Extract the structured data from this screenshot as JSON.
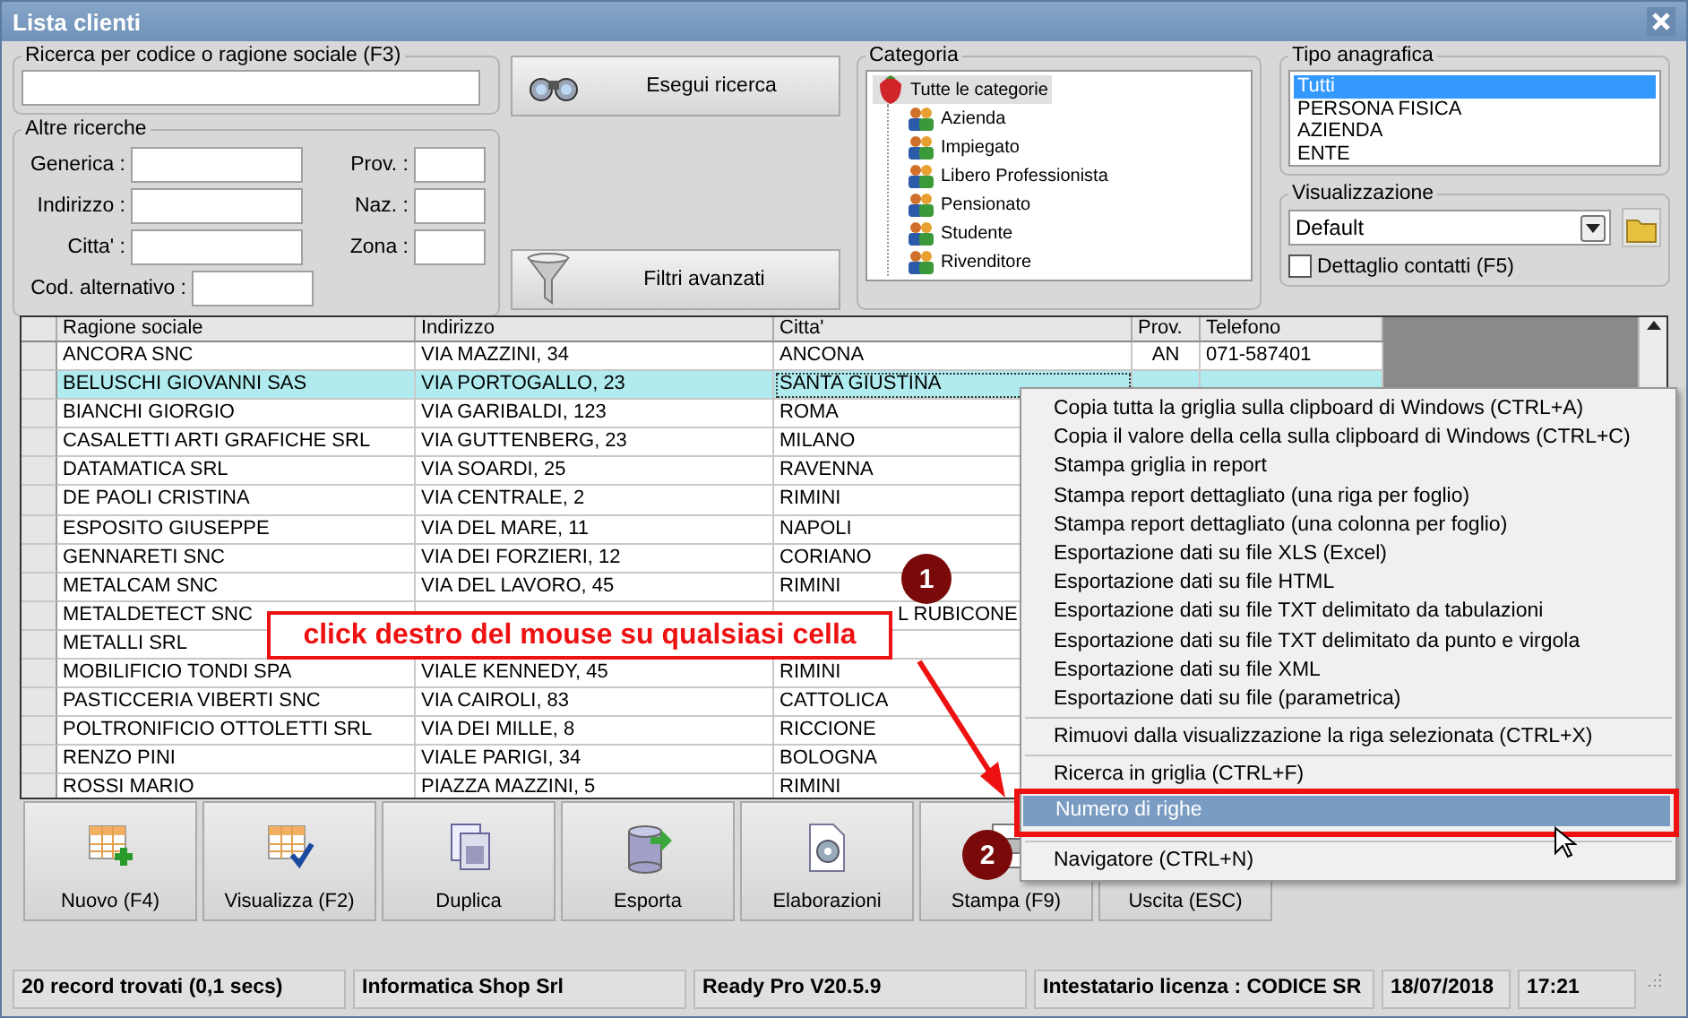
{
  "window": {
    "title": "Lista clienti"
  },
  "search": {
    "legend": "Ricerca per codice o ragione sociale (F3)"
  },
  "other_search": {
    "legend": "Altre ricerche",
    "rows": [
      {
        "fields": [
          {
            "label": "Generica :",
            "kind": "wide"
          },
          {
            "label": "Prov. :",
            "kind": "narrow"
          }
        ]
      },
      {
        "fields": [
          {
            "label": "Indirizzo :",
            "kind": "wide"
          },
          {
            "label": "Naz. :",
            "kind": "narrow"
          }
        ]
      },
      {
        "fields": [
          {
            "label": "Citta' :",
            "kind": "wide"
          },
          {
            "label": "Zona :",
            "kind": "narrow"
          }
        ]
      },
      {
        "fields": [
          {
            "label": "Cod. alternativo :",
            "kind": "medium"
          }
        ]
      }
    ]
  },
  "search_buttons": [
    {
      "label": "Esegui ricerca",
      "kind": "binoculars"
    },
    {
      "label": "Filtri avanzati",
      "kind": "funnel"
    }
  ],
  "category": {
    "legend": "Categoria",
    "tree": [
      {
        "label": "Tutte le categorie",
        "selected": true,
        "children": [
          {
            "label": "Azienda",
            "selected": false
          },
          {
            "label": "Impiegato",
            "selected": false
          },
          {
            "label": "Libero Professionista",
            "selected": false
          },
          {
            "label": "Pensionato",
            "selected": false
          },
          {
            "label": "Studente",
            "selected": false
          },
          {
            "label": "Rivenditore",
            "selected": false
          }
        ]
      }
    ]
  },
  "tipo": {
    "legend": "Tipo anagrafica",
    "items": [
      {
        "label": "Tutti",
        "selected": true
      },
      {
        "label": "PERSONA FISICA",
        "selected": false
      },
      {
        "label": "AZIENDA",
        "selected": false
      },
      {
        "label": "ENTE",
        "selected": false
      }
    ]
  },
  "view": {
    "legend": "Visualizzazione",
    "value": "Default",
    "detail": {
      "label": "Dettaglio contatti (F5)",
      "checked": false
    }
  },
  "grid": {
    "columns": [
      "Ragione sociale",
      "Indirizzo",
      "Citta'",
      "Prov.",
      "Telefono"
    ],
    "rows": [
      {
        "selected": false,
        "cells": [
          "ANCORA SNC",
          "VIA MAZZINI, 34",
          "ANCONA",
          "AN",
          "071-587401"
        ]
      },
      {
        "selected": true,
        "cells": [
          "BELUSCHI GIOVANNI SAS",
          "VIA PORTOGALLO, 23",
          {
            "text": "SANTA GIUSTINA",
            "focused": true
          },
          null,
          null
        ]
      },
      {
        "selected": false,
        "cells": [
          "BIANCHI GIORGIO",
          "VIA GARIBALDI, 123",
          "ROMA",
          null,
          null
        ]
      },
      {
        "selected": false,
        "cells": [
          "CASALETTI ARTI GRAFICHE SRL",
          "VIA GUTTENBERG, 23",
          "MILANO",
          null,
          null
        ]
      },
      {
        "selected": false,
        "cells": [
          "DATAMATICA SRL",
          "VIA SOARDI, 25",
          "RAVENNA",
          null,
          null
        ]
      },
      {
        "selected": false,
        "cells": [
          "DE PAOLI CRISTINA",
          "VIA CENTRALE, 2",
          "RIMINI",
          null,
          null
        ]
      },
      {
        "selected": false,
        "cells": [
          "ESPOSITO GIUSEPPE",
          "VIA DEL MARE, 11",
          "NAPOLI",
          null,
          null
        ]
      },
      {
        "selected": false,
        "cells": [
          "GENNARETI SNC",
          "VIA DEI FORZIERI, 12",
          "CORIANO",
          null,
          null
        ]
      },
      {
        "selected": false,
        "cells": [
          "METALCAM SNC",
          "VIA DEL LAVORO, 45",
          "RIMINI",
          null,
          null
        ]
      },
      {
        "selected": false,
        "cells": [
          "METALDETECT SNC",
          null,
          {
            "text": "L RUBICONE",
            "covered_start": true
          },
          null,
          null
        ]
      },
      {
        "selected": false,
        "cells": [
          "METALLI SRL",
          null,
          null,
          null,
          null
        ]
      },
      {
        "selected": false,
        "cells": [
          "MOBILIFICIO TONDI SPA",
          "VIALE KENNEDY, 45",
          "RIMINI",
          null,
          null
        ]
      },
      {
        "selected": false,
        "cells": [
          "PASTICCERIA VIBERTI SNC",
          "VIA CAIROLI, 83",
          "CATTOLICA",
          null,
          null
        ]
      },
      {
        "selected": false,
        "cells": [
          "POLTRONIFICIO OTTOLETTI SRL",
          "VIA DEI MILLE, 8",
          "RICCIONE",
          null,
          null
        ]
      },
      {
        "selected": false,
        "cells": [
          "RENZO PINI",
          "VIALE PARIGI, 34",
          "BOLOGNA",
          null,
          null
        ]
      },
      {
        "selected": false,
        "cells": [
          "ROSSI MARIO",
          "PIAZZA MAZZINI, 5",
          "RIMINI",
          null,
          null
        ]
      }
    ]
  },
  "actions": [
    {
      "label": "Nuovo (F4)",
      "kind": "new"
    },
    {
      "label": "Visualizza (F2)",
      "kind": "view"
    },
    {
      "label": "Duplica",
      "kind": "copy"
    },
    {
      "label": "Esporta",
      "kind": "export"
    },
    {
      "label": "Elaborazioni",
      "kind": "process"
    },
    {
      "label": "Stampa (F9)",
      "kind": "print"
    },
    {
      "label": "Uscita (ESC)",
      "kind": "exit"
    }
  ],
  "status_bar": [
    "20 record trovati (0,1 secs)",
    "Informatica Shop Srl",
    "Ready Pro V20.5.9",
    "Intestatario licenza : CODICE SR",
    "18/07/2018",
    "17:21"
  ],
  "context_menu": [
    {
      "kind": "item",
      "label": "Copia tutta la griglia sulla clipboard di Windows (CTRL+A)",
      "selected": false
    },
    {
      "kind": "item",
      "label": "Copia il valore della cella sulla clipboard di Windows (CTRL+C)",
      "selected": false
    },
    {
      "kind": "item",
      "label": "Stampa griglia in report",
      "selected": false
    },
    {
      "kind": "item",
      "label": "Stampa report dettagliato (una riga per foglio)",
      "selected": false
    },
    {
      "kind": "item",
      "label": "Stampa report dettagliato (una colonna per foglio)",
      "selected": false
    },
    {
      "kind": "item",
      "label": "Esportazione dati su file XLS (Excel)",
      "selected": false
    },
    {
      "kind": "item",
      "label": "Esportazione dati su file HTML",
      "selected": false
    },
    {
      "kind": "item",
      "label": "Esportazione dati su file TXT delimitato da tabulazioni",
      "selected": false
    },
    {
      "kind": "item",
      "label": "Esportazione dati su file TXT delimitato da punto e virgola",
      "selected": false
    },
    {
      "kind": "item",
      "label": "Esportazione dati su file XML",
      "selected": false
    },
    {
      "kind": "item",
      "label": "Esportazione dati su file (parametrica)",
      "selected": false
    },
    {
      "kind": "separator"
    },
    {
      "kind": "item",
      "label": "Rimuovi dalla visualizzazione la riga selezionata (CTRL+X)",
      "selected": false
    },
    {
      "kind": "separator"
    },
    {
      "kind": "item",
      "label": "Ricerca in griglia (CTRL+F)",
      "selected": false
    },
    {
      "kind": "item",
      "label": "Numero di righe",
      "selected": true
    },
    {
      "kind": "separator"
    },
    {
      "kind": "item",
      "label": "Navigatore (CTRL+N)",
      "selected": false
    }
  ],
  "annotations": {
    "callout": "click destro del mouse su qualsiasi cella",
    "badges": [
      "1",
      "2"
    ]
  }
}
